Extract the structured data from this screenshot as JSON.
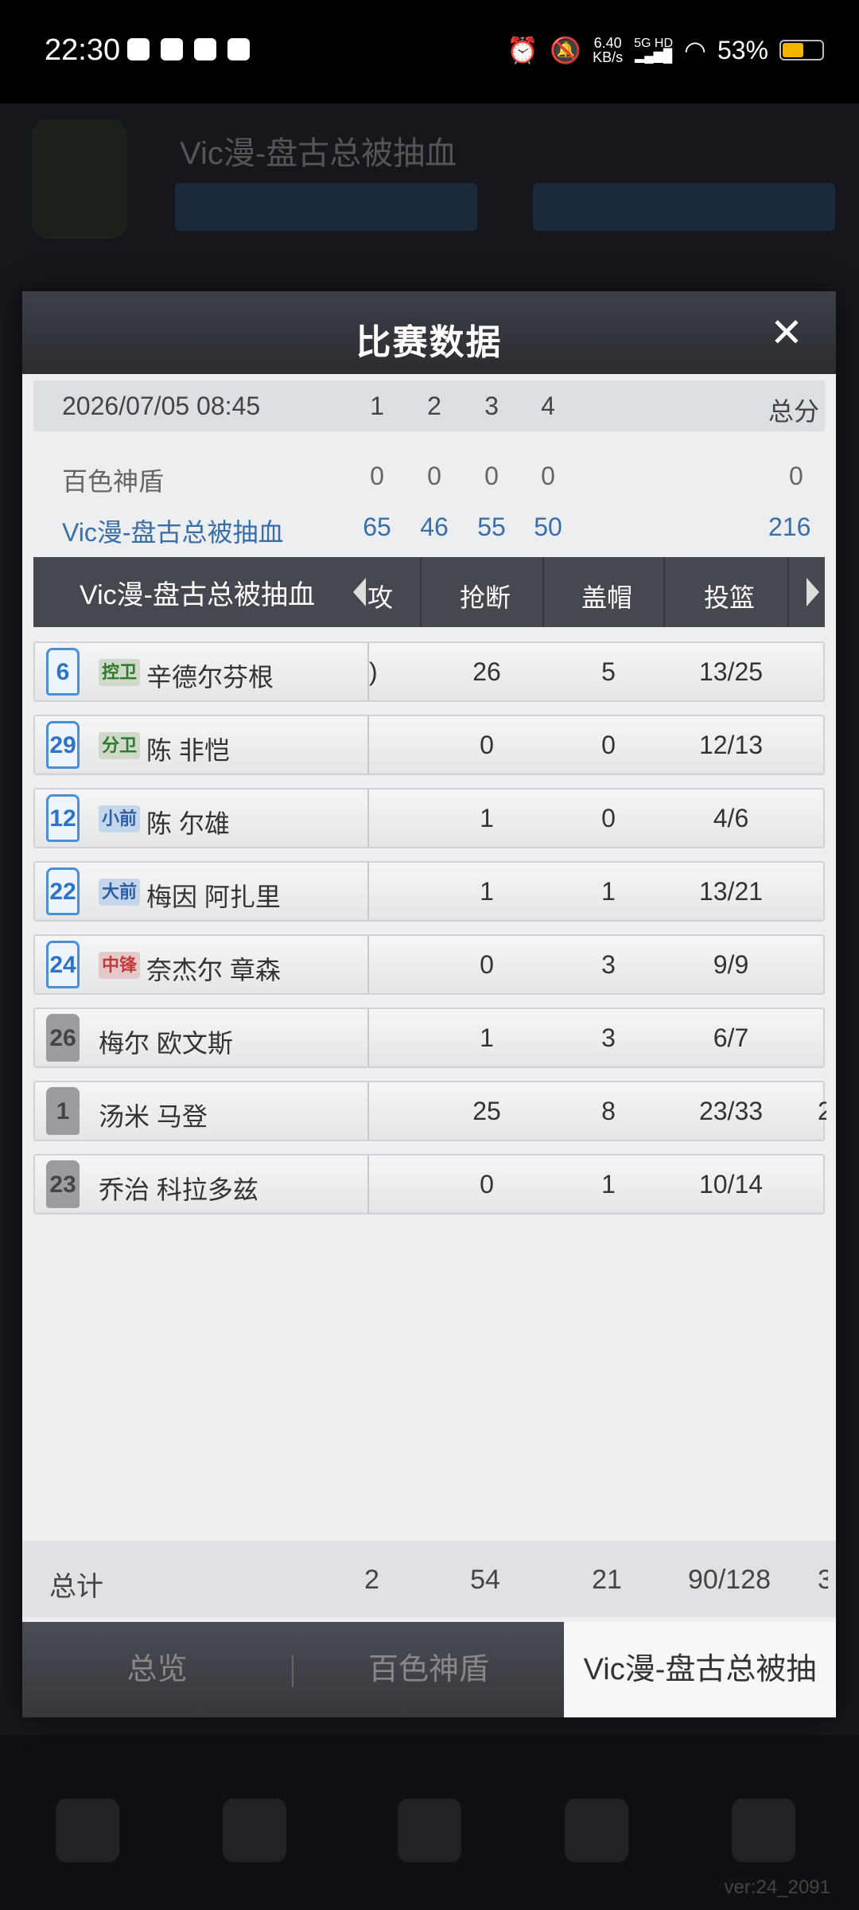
{
  "status_bar": {
    "time": "22:30",
    "net_speed": "6.40",
    "net_unit": "KB/s",
    "signal": "5G HD",
    "battery": "53%"
  },
  "background": {
    "title": "Vic漫-盘古总被抽血",
    "version": "ver:24_2091"
  },
  "dialog": {
    "title": "比赛数据",
    "score_header": {
      "date": "2026/07/05 08:45",
      "quarters": [
        "1",
        "2",
        "3",
        "4"
      ],
      "total_label": "总分"
    },
    "teams": [
      {
        "name": "百色神盾",
        "quarters": [
          "0",
          "0",
          "0",
          "0"
        ],
        "total": "0"
      },
      {
        "name": "Vic漫-盘古总被抽血",
        "quarters": [
          "65",
          "46",
          "55",
          "50"
        ],
        "total": "216"
      }
    ],
    "table": {
      "team_name": "Vic漫-盘古总被抽血",
      "partial_col": "攻",
      "columns": [
        "抢断",
        "盖帽",
        "投篮"
      ]
    },
    "players": [
      {
        "number": "6",
        "position": "控卫",
        "name": "辛德尔芬根",
        "partial": ")",
        "steals": "26",
        "blocks": "5",
        "shots": "13/25"
      },
      {
        "number": "29",
        "position": "分卫",
        "name": "陈 非恺",
        "partial": "",
        "steals": "0",
        "blocks": "0",
        "shots": "12/13"
      },
      {
        "number": "12",
        "position": "小前",
        "name": "陈 尔雄",
        "partial": "",
        "steals": "1",
        "blocks": "0",
        "shots": "4/6"
      },
      {
        "number": "22",
        "position": "大前",
        "name": "梅因 阿扎里",
        "partial": "",
        "steals": "1",
        "blocks": "1",
        "shots": "13/21"
      },
      {
        "number": "24",
        "position": "中锋",
        "name": "奈杰尔 章森",
        "partial": "",
        "steals": "0",
        "blocks": "3",
        "shots": "9/9"
      },
      {
        "number": "26",
        "position": "",
        "name": "梅尔 欧文斯",
        "partial": "",
        "steals": "1",
        "blocks": "3",
        "shots": "6/7"
      },
      {
        "number": "1",
        "position": "",
        "name": "汤米 马登",
        "partial": "",
        "steals": "25",
        "blocks": "8",
        "shots": "23/33",
        "right_partial": "2"
      },
      {
        "number": "23",
        "position": "",
        "name": "乔治 科拉多兹",
        "partial": "",
        "steals": "0",
        "blocks": "1",
        "shots": "10/14"
      }
    ],
    "totals": {
      "label": "总计",
      "partial": "2",
      "steals": "54",
      "blocks": "21",
      "shots": "90/128",
      "right_partial": "3"
    },
    "tabs": [
      "总览",
      "百色神盾",
      "Vic漫-盘古总被抽"
    ]
  }
}
